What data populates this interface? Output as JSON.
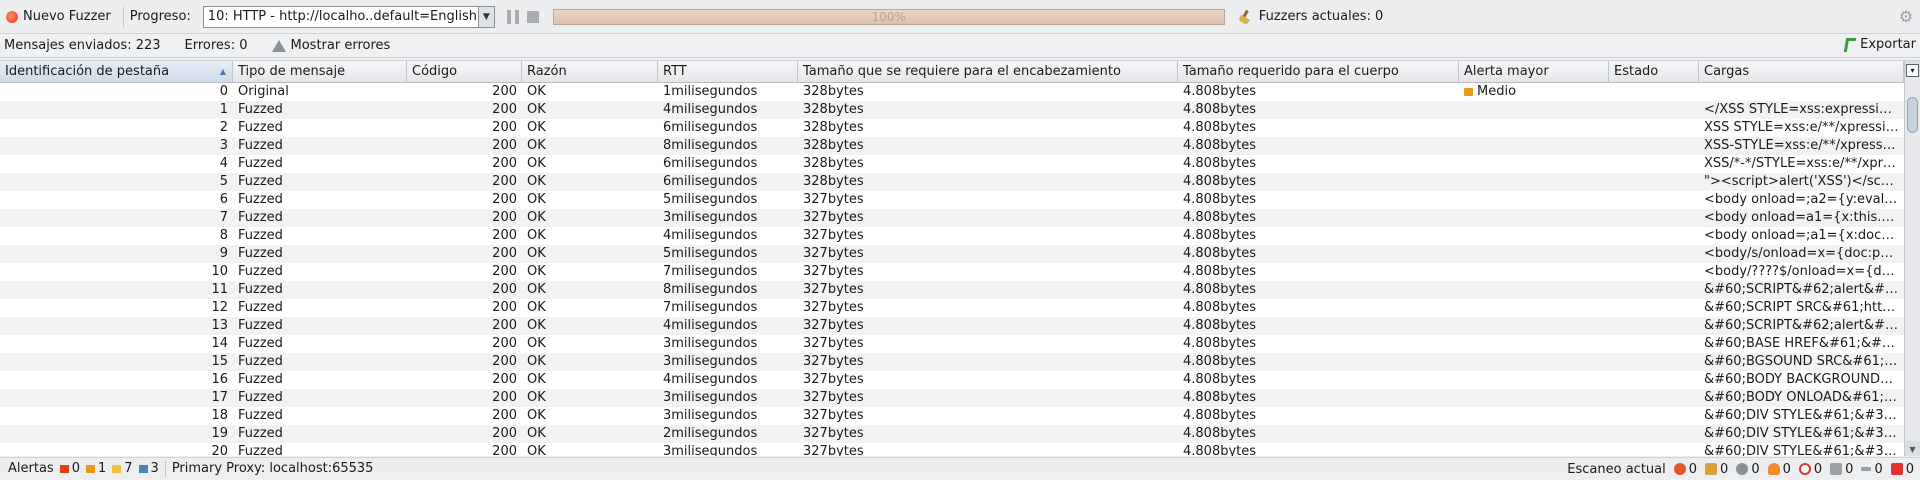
{
  "toolbar": {
    "new_fuzzer": "Nuevo Fuzzer",
    "progress_label": "Progreso:",
    "selected_fuzzer": "10: HTTP - http://localho..default=English",
    "progress_value": 1.0,
    "progress_text": "100%",
    "current_fuzzers": "Fuzzers actuales: 0"
  },
  "info": {
    "messages_sent": "Mensajes enviados: 223",
    "errors": "Errores: 0",
    "show_errors": "Mostrar errores",
    "export": "Exportar"
  },
  "table": {
    "columns": [
      "Identificación de pestaña",
      "Tipo de mensaje",
      "Código",
      "Razón",
      "RTT",
      "Tamaño que se requiere para el encabezamiento",
      "Tamaño requerido para el cuerpo",
      "Alerta mayor",
      "Estado",
      "Cargas"
    ],
    "rows": [
      {
        "id": "0",
        "type": "Original",
        "code": "200",
        "reason": "OK",
        "rtt": "1milisegundos",
        "hsize": "328bytes",
        "bsize": "4.808bytes",
        "alert": "Medio",
        "state": "",
        "payload": ""
      },
      {
        "id": "1",
        "type": "Fuzzed",
        "code": "200",
        "reason": "OK",
        "rtt": "4milisegundos",
        "hsize": "328bytes",
        "bsize": "4.808bytes",
        "alert": "",
        "state": "",
        "payload": "</XSS STYLE=xss:expression..."
      },
      {
        "id": "2",
        "type": "Fuzzed",
        "code": "200",
        "reason": "OK",
        "rtt": "6milisegundos",
        "hsize": "328bytes",
        "bsize": "4.808bytes",
        "alert": "",
        "state": "",
        "payload": "XSS STYLE=xss:e/**/xpressio..."
      },
      {
        "id": "3",
        "type": "Fuzzed",
        "code": "200",
        "reason": "OK",
        "rtt": "8milisegundos",
        "hsize": "328bytes",
        "bsize": "4.808bytes",
        "alert": "",
        "state": "",
        "payload": "XSS-STYLE=xss:e/**/xpressio..."
      },
      {
        "id": "4",
        "type": "Fuzzed",
        "code": "200",
        "reason": "OK",
        "rtt": "6milisegundos",
        "hsize": "328bytes",
        "bsize": "4.808bytes",
        "alert": "",
        "state": "",
        "payload": "XSS/*-*/STYLE=xss:e/**/xpres..."
      },
      {
        "id": "5",
        "type": "Fuzzed",
        "code": "200",
        "reason": "OK",
        "rtt": "6milisegundos",
        "hsize": "328bytes",
        "bsize": "4.808bytes",
        "alert": "",
        "state": "",
        "payload": "\"><script>alert('XSS')</scrip..."
      },
      {
        "id": "6",
        "type": "Fuzzed",
        "code": "200",
        "reason": "OK",
        "rtt": "5milisegundos",
        "hsize": "327bytes",
        "bsize": "4.808bytes",
        "alert": "",
        "state": "",
        "payload": "<body onload=;a2={y:eval};..."
      },
      {
        "id": "7",
        "type": "Fuzzed",
        "code": "200",
        "reason": "OK",
        "rtt": "3milisegundos",
        "hsize": "327bytes",
        "bsize": "4.808bytes",
        "alert": "",
        "state": "",
        "payload": "<body onload=a1={x:this.p..."
      },
      {
        "id": "8",
        "type": "Fuzzed",
        "code": "200",
        "reason": "OK",
        "rtt": "4milisegundos",
        "hsize": "327bytes",
        "bsize": "4.808bytes",
        "alert": "",
        "state": "",
        "payload": "<body onload=;a1={x:docu..."
      },
      {
        "id": "9",
        "type": "Fuzzed",
        "code": "200",
        "reason": "OK",
        "rtt": "5milisegundos",
        "hsize": "327bytes",
        "bsize": "4.808bytes",
        "alert": "",
        "state": "",
        "payload": "<body/s/onload=x={doc:par..."
      },
      {
        "id": "10",
        "type": "Fuzzed",
        "code": "200",
        "reason": "OK",
        "rtt": "7milisegundos",
        "hsize": "327bytes",
        "bsize": "4.808bytes",
        "alert": "",
        "state": "",
        "payload": "<body/????$/onload=x={doc..."
      },
      {
        "id": "11",
        "type": "Fuzzed",
        "code": "200",
        "reason": "OK",
        "rtt": "8milisegundos",
        "hsize": "327bytes",
        "bsize": "4.808bytes",
        "alert": "",
        "state": "",
        "payload": "&#60;SCRIPT&#62;alert&#4..."
      },
      {
        "id": "12",
        "type": "Fuzzed",
        "code": "200",
        "reason": "OK",
        "rtt": "7milisegundos",
        "hsize": "327bytes",
        "bsize": "4.808bytes",
        "alert": "",
        "state": "",
        "payload": "&#60;SCRIPT SRC&#61;http..."
      },
      {
        "id": "13",
        "type": "Fuzzed",
        "code": "200",
        "reason": "OK",
        "rtt": "4milisegundos",
        "hsize": "327bytes",
        "bsize": "4.808bytes",
        "alert": "",
        "state": "",
        "payload": "&#60;SCRIPT&#62;alert&#4..."
      },
      {
        "id": "14",
        "type": "Fuzzed",
        "code": "200",
        "reason": "OK",
        "rtt": "3milisegundos",
        "hsize": "327bytes",
        "bsize": "4.808bytes",
        "alert": "",
        "state": "",
        "payload": "&#60;BASE HREF&#61;&#3..."
      },
      {
        "id": "15",
        "type": "Fuzzed",
        "code": "200",
        "reason": "OK",
        "rtt": "3milisegundos",
        "hsize": "327bytes",
        "bsize": "4.808bytes",
        "alert": "",
        "state": "",
        "payload": "&#60;BGSOUND SRC&#61;&..."
      },
      {
        "id": "16",
        "type": "Fuzzed",
        "code": "200",
        "reason": "OK",
        "rtt": "4milisegundos",
        "hsize": "327bytes",
        "bsize": "4.808bytes",
        "alert": "",
        "state": "",
        "payload": "&#60;BODY BACKGROUND&..."
      },
      {
        "id": "17",
        "type": "Fuzzed",
        "code": "200",
        "reason": "OK",
        "rtt": "3milisegundos",
        "hsize": "327bytes",
        "bsize": "4.808bytes",
        "alert": "",
        "state": "",
        "payload": "&#60;BODY ONLOAD&#61;al..."
      },
      {
        "id": "18",
        "type": "Fuzzed",
        "code": "200",
        "reason": "OK",
        "rtt": "3milisegundos",
        "hsize": "327bytes",
        "bsize": "4.808bytes",
        "alert": "",
        "state": "",
        "payload": "&#60;DIV STYLE&#61;&#34;..."
      },
      {
        "id": "19",
        "type": "Fuzzed",
        "code": "200",
        "reason": "OK",
        "rtt": "2milisegundos",
        "hsize": "327bytes",
        "bsize": "4.808bytes",
        "alert": "",
        "state": "",
        "payload": "&#60;DIV STYLE&#61;&#34;..."
      },
      {
        "id": "20",
        "type": "Fuzzed",
        "code": "200",
        "reason": "OK",
        "rtt": "3milisegundos",
        "hsize": "327bytes",
        "bsize": "4.808bytes",
        "alert": "",
        "state": "",
        "payload": "&#60;DIV STYLE&#61;&#34;..."
      }
    ]
  },
  "status": {
    "alerts_label": "Alertas",
    "alert_high": "0",
    "alert_medium": "1",
    "alert_low": "7",
    "alert_info": "3",
    "proxy": "Primary Proxy: localhost:65535",
    "scan_label": "Escaneo actual",
    "counters": [
      "0",
      "0",
      "0",
      "0",
      "0",
      "0",
      "0",
      "0"
    ]
  },
  "colors": {
    "high": "#e33a1a",
    "medium": "#e89a1a",
    "low": "#f0c040",
    "info": "#4a7fc0"
  }
}
